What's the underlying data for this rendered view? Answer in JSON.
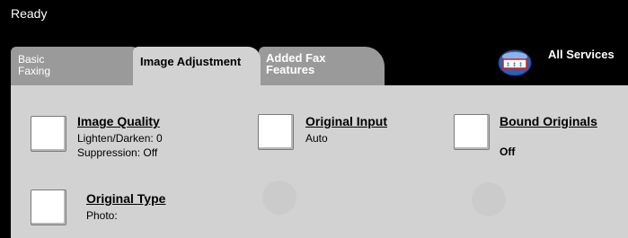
{
  "status": {
    "text": "Ready"
  },
  "tabs": [
    {
      "label": "Basic\nFaxing"
    },
    {
      "label": "Image Adjustment"
    },
    {
      "label": "Added Fax\nFeatures"
    }
  ],
  "all_services": {
    "label": "All Services",
    "icon": "services-icon"
  },
  "options": {
    "image_quality": {
      "title": "Image Quality",
      "line1": "Lighten/Darken: 0",
      "line2": "Suppression: Off"
    },
    "original_input": {
      "title": "Original Input",
      "value": "Auto"
    },
    "bound_originals": {
      "title": "Bound Originals",
      "value": "Off"
    },
    "original_type": {
      "title": "Original Type",
      "value": "Photo:"
    }
  }
}
